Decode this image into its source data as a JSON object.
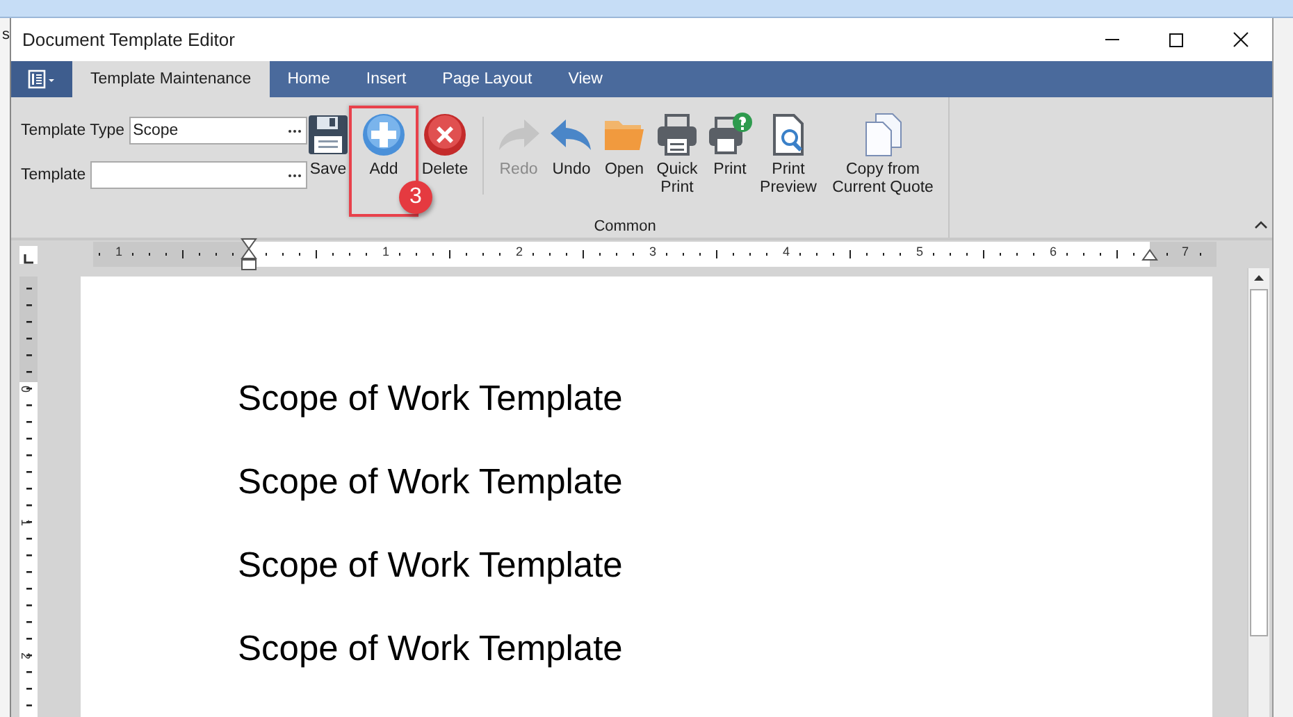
{
  "background_window": {
    "text": "s"
  },
  "window": {
    "title": "Document Template Editor"
  },
  "tabs": [
    {
      "label": "Template Maintenance",
      "selected": true
    },
    {
      "label": "Home",
      "selected": false
    },
    {
      "label": "Insert",
      "selected": false
    },
    {
      "label": "Page Layout",
      "selected": false
    },
    {
      "label": "View",
      "selected": false
    }
  ],
  "fields": [
    {
      "label": "Template Type",
      "value": "Scope"
    },
    {
      "label": "Template"
    }
  ],
  "ribbon_buttons": [
    {
      "kind": "save",
      "label": "Save",
      "disabled": false,
      "highlighted": false
    },
    {
      "kind": "add",
      "label": "Add",
      "disabled": false,
      "highlighted": true,
      "callout": "3"
    },
    {
      "kind": "delete",
      "label": "Delete",
      "disabled": false,
      "highlighted": false
    },
    {
      "kind": "redo",
      "label": "Redo",
      "disabled": true,
      "highlighted": false
    },
    {
      "kind": "undo",
      "label": "Undo",
      "disabled": false,
      "highlighted": false
    },
    {
      "kind": "open",
      "label": "Open",
      "disabled": false,
      "highlighted": false
    },
    {
      "kind": "quickprint",
      "label": "Quick Print",
      "disabled": false,
      "highlighted": false
    },
    {
      "kind": "print",
      "label": "Print",
      "disabled": false,
      "highlighted": false
    },
    {
      "kind": "preview",
      "label": "Print Preview",
      "disabled": false,
      "highlighted": false
    },
    {
      "kind": "copy",
      "label": "Copy from Current Quote",
      "disabled": false,
      "highlighted": false
    }
  ],
  "ribbon_group": "Common",
  "ruler": {
    "horizontal_numbers": [
      "1",
      "1",
      "2",
      "3",
      "4",
      "5",
      "6",
      "7"
    ],
    "vertical_numbers": [
      "0",
      "1",
      "2"
    ]
  },
  "document": {
    "lines": [
      "Scope of Work Template",
      "Scope of Work Template",
      "Scope of Work Template",
      "Scope of Work Template"
    ]
  }
}
